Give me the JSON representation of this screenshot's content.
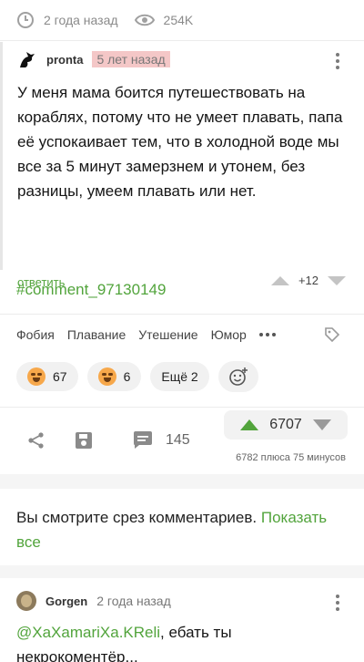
{
  "post_meta": {
    "age": "2 года назад",
    "views": "254K"
  },
  "comment": {
    "username": "pronta",
    "time": "5 лет назад",
    "text": "У меня мама боится путешествовать на кораблях, потому что не умеет плавать, папа её успокаивает тем, что в холодной воде мы все за 5 минут замерзнем и утонем, без разницы, умеем плавать или нет.",
    "reply_label": "ответить",
    "rating": "+12"
  },
  "hashtag": "#comment_97130149",
  "tags": [
    "Фобия",
    "Плавание",
    "Утешение",
    "Юмор"
  ],
  "reactions": [
    {
      "icon": "grinning-emoji-icon",
      "count": "67"
    },
    {
      "icon": "smiling-halo-emoji-icon",
      "count": "6"
    }
  ],
  "reactions_more": "Ещё 2",
  "actions": {
    "comments_count": "145"
  },
  "post_rating": {
    "value": "6707",
    "detail": "6782 плюса 75 минусов"
  },
  "notice": {
    "text": "Вы смотрите срез комментариев. ",
    "link": "Показать все"
  },
  "comment2": {
    "username": "Gorgen",
    "time": "2 года назад",
    "mention": "@XaXamariXa.KReli",
    "text": ",  ебать ты некрокоментёр..."
  },
  "colors": {
    "accent_green": "#52a43c",
    "time_highlight": "#f4c7c7",
    "muted": "#8a8a8a"
  }
}
